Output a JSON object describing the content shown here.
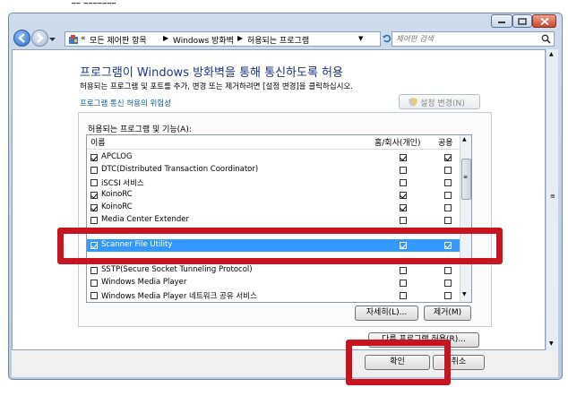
{
  "address": {
    "crumb1": "모든 제어판 항목",
    "crumb2": "Windows 방화벽",
    "crumb3": "허용되는 프로그램"
  },
  "search": {
    "placeholder": "제어판 검색"
  },
  "page": {
    "title": "프로그램이 Windows 방화벽을 통해 통신하도록 허용",
    "description": "허용되는 프로그램 및 포트를 추가, 변경 또는 제거하려면 [설정 변경]을 클릭하십시오.",
    "risk_link": "프로그램 통신 허용의 위험성",
    "change_settings": "설정 변경(N)",
    "allowed_label": "허용되는 프로그램 및 기능(A):"
  },
  "list": {
    "headers": {
      "name": "이름",
      "home": "홈/회사(개인)",
      "public": "공용"
    },
    "rows": [
      {
        "name": "APCLOG",
        "enabled": true,
        "home": true,
        "public": true,
        "selected": false
      },
      {
        "name": "DTC(Distributed Transaction Coordinator)",
        "enabled": false,
        "home": false,
        "public": false,
        "selected": false
      },
      {
        "name": "iSCSI 서비스",
        "enabled": false,
        "home": false,
        "public": false,
        "selected": false
      },
      {
        "name": "KoinoRC",
        "enabled": true,
        "home": true,
        "public": false,
        "selected": false
      },
      {
        "name": "KoinoRC",
        "enabled": true,
        "home": true,
        "public": false,
        "selected": false
      },
      {
        "name": "Media Center Extender",
        "enabled": false,
        "home": false,
        "public": false,
        "selected": false
      },
      {
        "name": "Scanner File Utility",
        "enabled": true,
        "home": true,
        "public": true,
        "selected": true
      },
      {
        "name": "SSTP(Secure Socket Tunneling Protocol)",
        "enabled": false,
        "home": false,
        "public": false,
        "selected": false
      },
      {
        "name": "Windows Media Player",
        "enabled": false,
        "home": false,
        "public": false,
        "selected": false
      },
      {
        "name": "Windows Media Player 네트워크 공유 서비스",
        "enabled": false,
        "home": false,
        "public": false,
        "selected": false
      }
    ]
  },
  "buttons": {
    "details": "자세히(L)...",
    "remove": "제거(M)",
    "allow_other": "다른 프로그램 허용(R)...",
    "ok": "확인",
    "cancel": "취소"
  }
}
